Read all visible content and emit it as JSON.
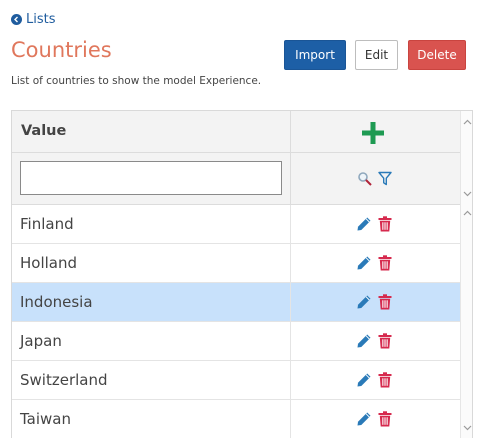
{
  "nav": {
    "back_label": "Lists"
  },
  "header": {
    "title": "Countries",
    "subtitle": "List of countries to show the model Experience."
  },
  "toolbar": {
    "import_label": "Import",
    "edit_label": "Edit",
    "delete_label": "Delete"
  },
  "grid": {
    "column_value": "Value",
    "filter": {
      "value": "",
      "placeholder": ""
    },
    "rows": [
      {
        "value": "Finland",
        "selected": false
      },
      {
        "value": "Holland",
        "selected": false
      },
      {
        "value": "Indonesia",
        "selected": true
      },
      {
        "value": "Japan",
        "selected": false
      },
      {
        "value": "Switzerland",
        "selected": false
      },
      {
        "value": "Taiwan",
        "selected": false
      }
    ]
  },
  "colors": {
    "title": "#e0775c",
    "link": "#1f5c9e",
    "import_button": "#1d5fa6",
    "delete_button": "#d9534f",
    "add_icon": "#1e9a52",
    "edit_icon": "#2a7ab8",
    "delete_icon": "#d62a4e",
    "selected_row": "#c8e1fb"
  },
  "icons": {
    "back": "circle-arrow-left-icon",
    "add": "plus-icon",
    "search": "magnifier-icon",
    "filter": "funnel-icon",
    "edit": "pencil-icon",
    "delete": "trash-icon"
  }
}
